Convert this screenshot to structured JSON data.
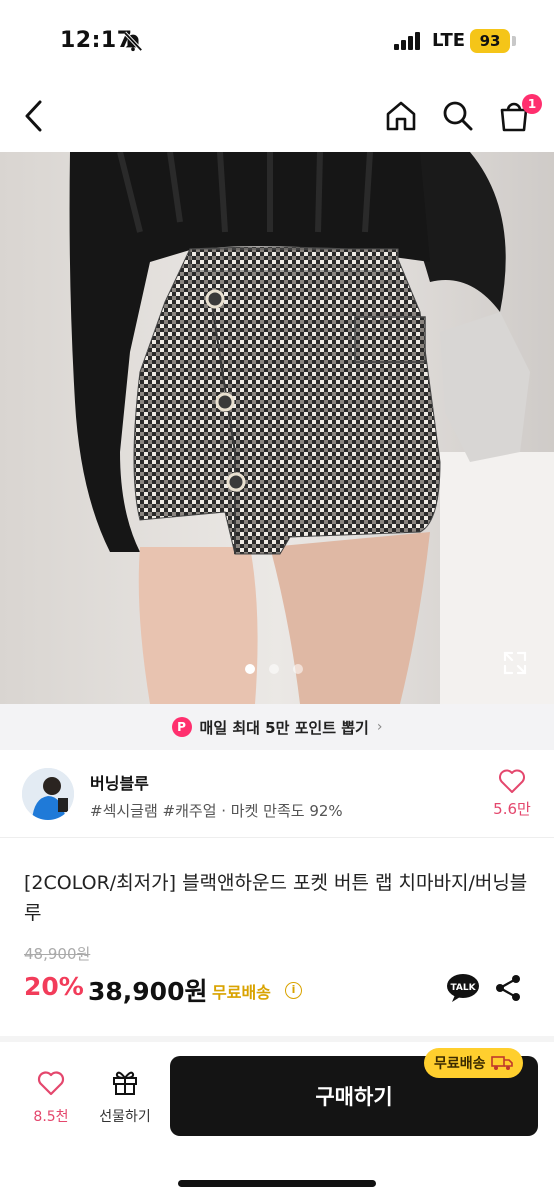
{
  "status_bar": {
    "time": "12:17",
    "network": "LTE",
    "battery": "93"
  },
  "nav": {
    "cart_count": "1"
  },
  "carousel": {
    "total": 3,
    "active_index": 0
  },
  "promo": {
    "badge": "P",
    "text": "매일 최대 5만 포인트 뽑기",
    "chevron": "›"
  },
  "seller": {
    "name": "버닝블루",
    "meta": "#섹시글램 #캐주얼 · 마켓 만족도 92%",
    "likes": "5.6만"
  },
  "product": {
    "title": "[2COLOR/최저가] 블랙앤하운드 포켓 버튼 랩 치마바지/버닝블루",
    "original_price": "48,900원",
    "discount": "20%",
    "price": "38,900원",
    "free_shipping": "무료배송",
    "info": "i",
    "talk": "TALK"
  },
  "bottom_bar": {
    "likes": "8.5천",
    "gift_label": "선물하기",
    "buy_label": "구매하기",
    "shipping_tag": "무료배송"
  },
  "colors": {
    "accent": "#ff2f6e",
    "discount": "#f23c5a",
    "shipping": "#d9a300",
    "button": "#141414",
    "tag": "#ffcf2e"
  }
}
